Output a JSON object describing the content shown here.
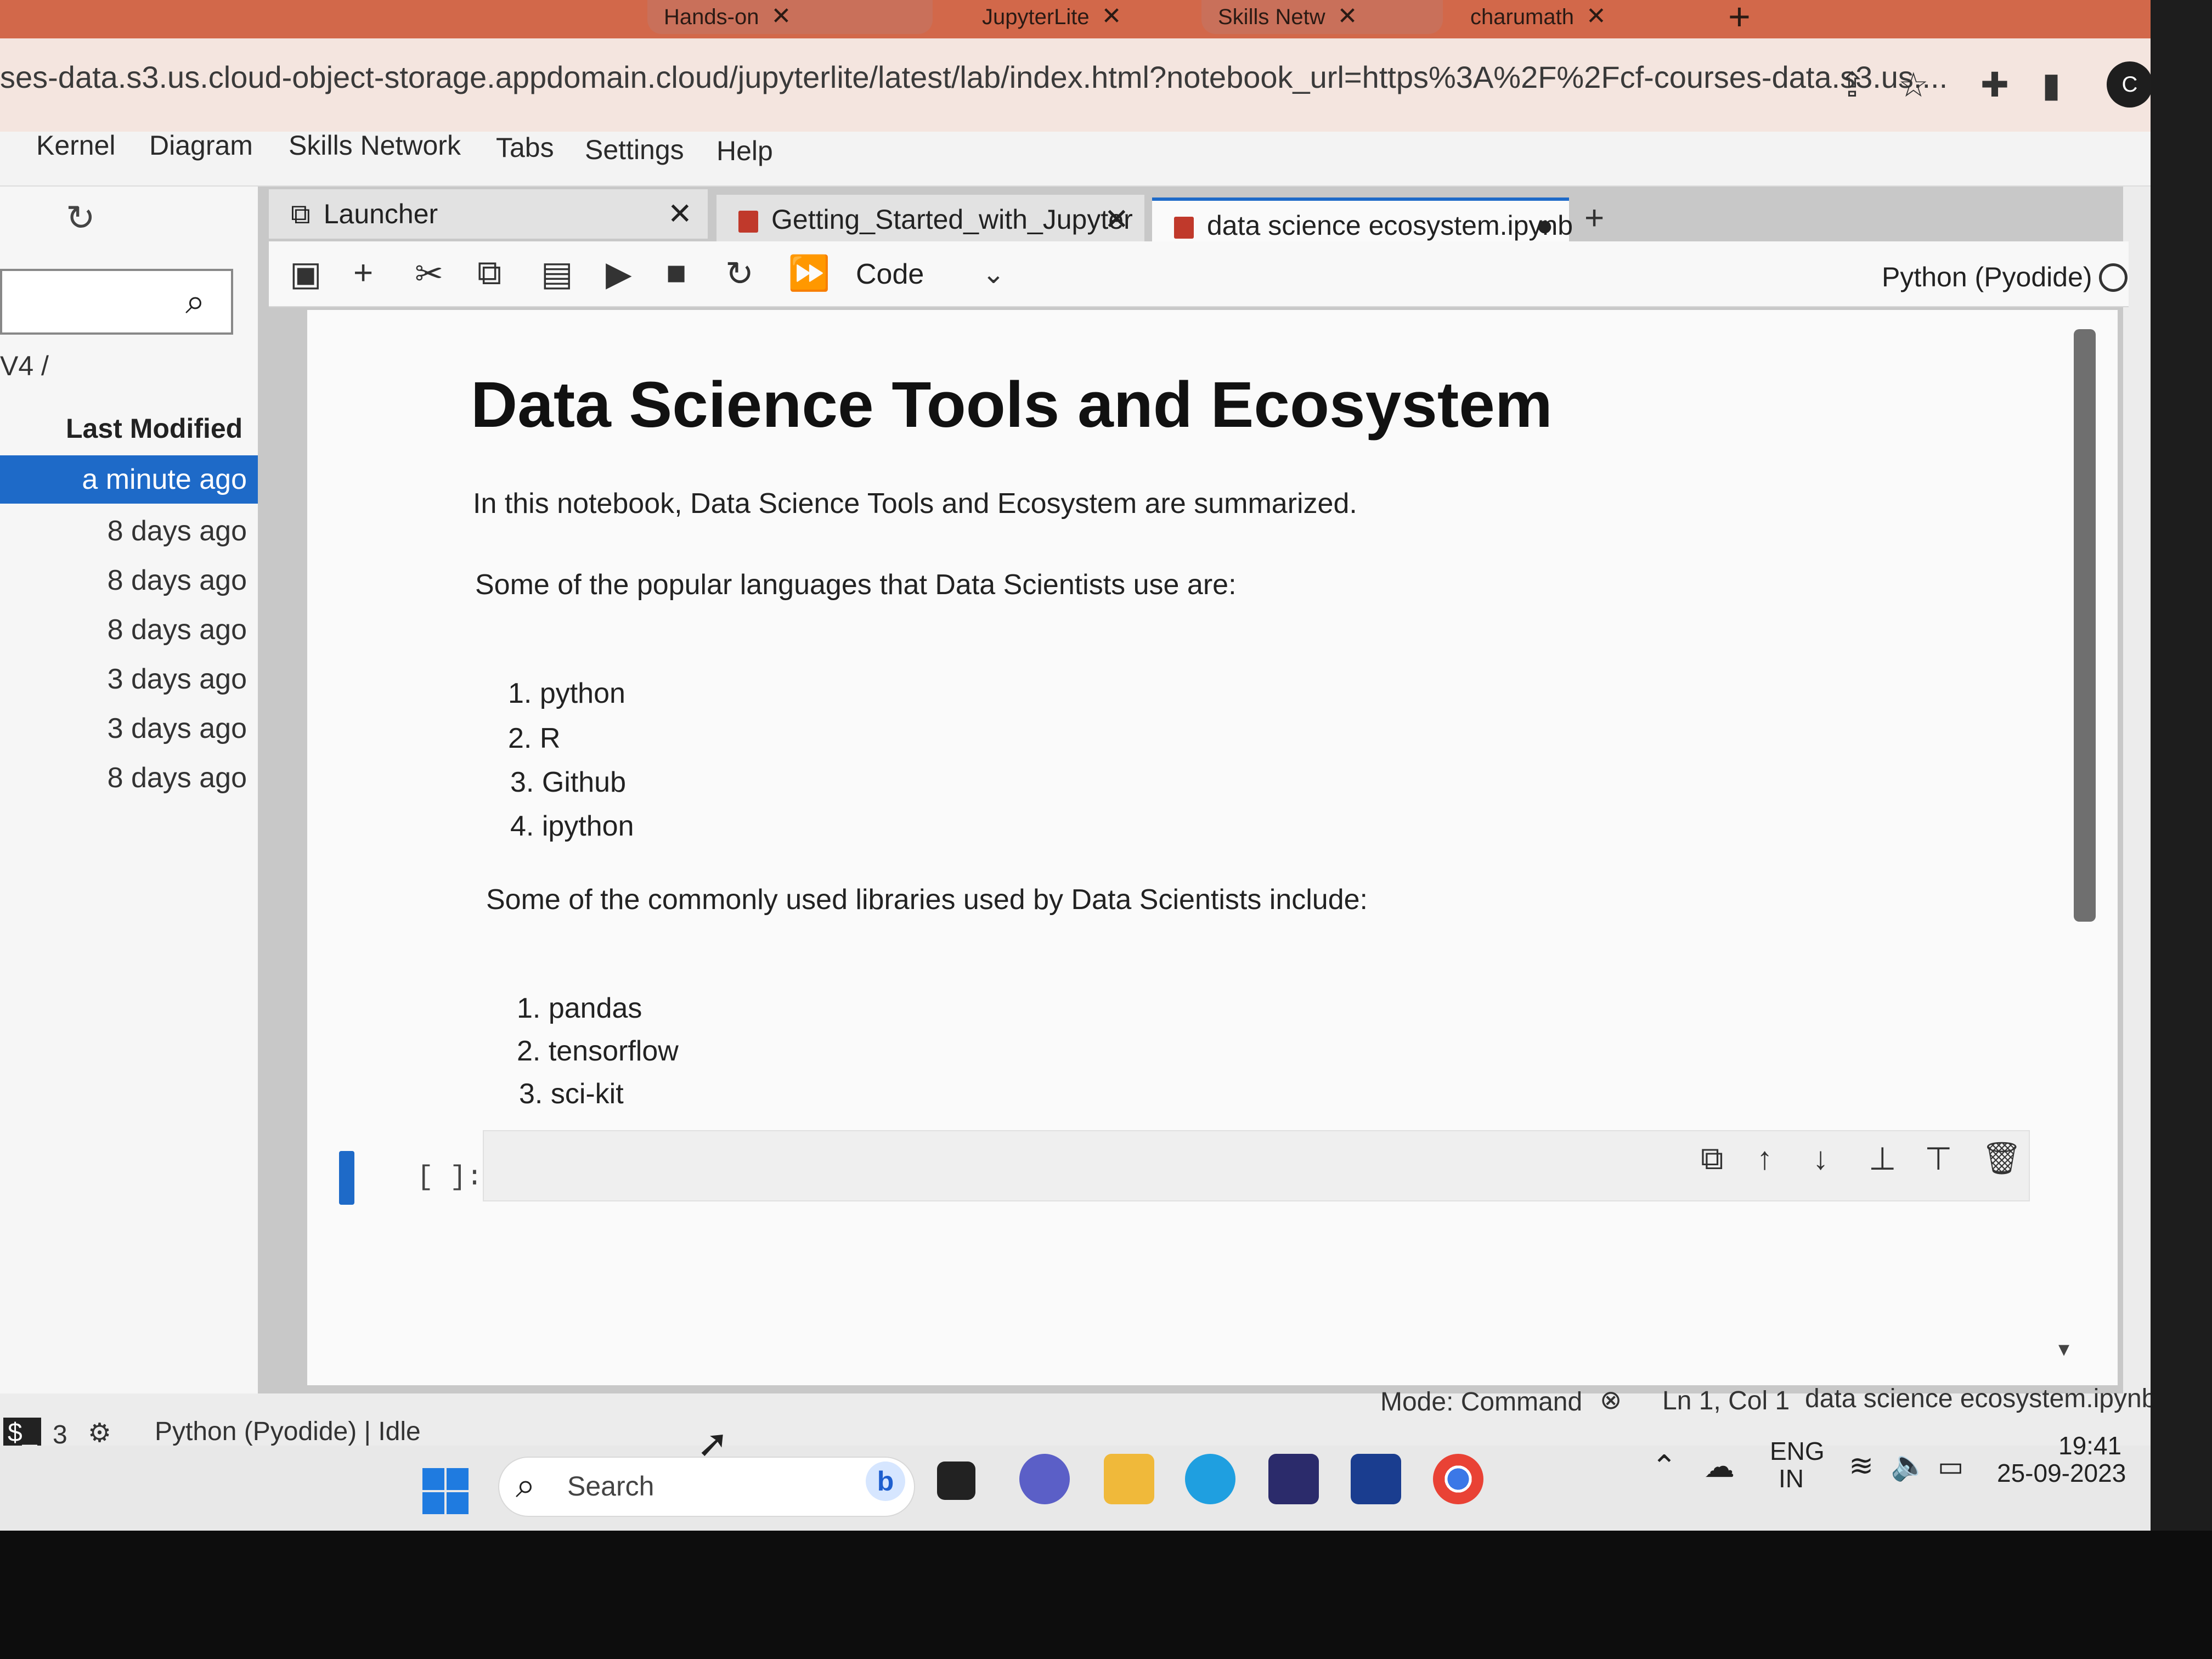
{
  "browser": {
    "tabs": [
      {
        "label": "Hands-on"
      },
      {
        "label": "JupyterLite"
      },
      {
        "label": "Skills Netw"
      },
      {
        "label": "charumath"
      }
    ],
    "url": "ses-data.s3.us.cloud-object-storage.appdomain.cloud/jupyterlite/latest/lab/index.html?notebook_url=https%3A%2F%2Fcf-courses-data.s3.us....",
    "profile_initial": "C"
  },
  "menu": [
    "Kernel",
    "Diagram",
    "Skills Network",
    "Tabs",
    "Settings",
    "Help"
  ],
  "filebrowser": {
    "breadcrumb": "V4 /",
    "column_header": "Last Modified",
    "rows": [
      "a minute ago",
      "8 days ago",
      "8 days ago",
      "8 days ago",
      "3 days ago",
      "3 days ago",
      "8 days ago"
    ]
  },
  "doc_tabs": [
    {
      "label": "Launcher"
    },
    {
      "label": "Getting_Started_with_Jupyter"
    },
    {
      "label": "data science ecosystem.ipynb"
    }
  ],
  "toolbar": {
    "cell_type": "Code",
    "kernel": "Python (Pyodide)"
  },
  "notebook": {
    "title": "Data Science Tools and Ecosystem",
    "intro": "In this notebook, Data Science Tools and Ecosystem are summarized.",
    "languages_intro": "Some of the popular languages that Data Scientists use are:",
    "languages": [
      "1. python",
      "2. R",
      "3. Github",
      "4. ipython"
    ],
    "libraries_intro": "Some of the commonly used libraries used by Data Scientists include:",
    "libraries": [
      "1. pandas",
      "2. tensorflow",
      "3. sci-kit"
    ],
    "prompt": "[ ]:"
  },
  "statusbar": {
    "mode": "Mode: Command",
    "position": "Ln 1, Col 1",
    "file": "data science ecosystem.ipynb",
    "terminals": "3",
    "kernel_status": "Python (Pyodide) | Idle"
  },
  "taskbar": {
    "search_label": "Search",
    "lang": "ENG",
    "region": "IN",
    "time": "19:41",
    "date": "25-09-2023"
  }
}
